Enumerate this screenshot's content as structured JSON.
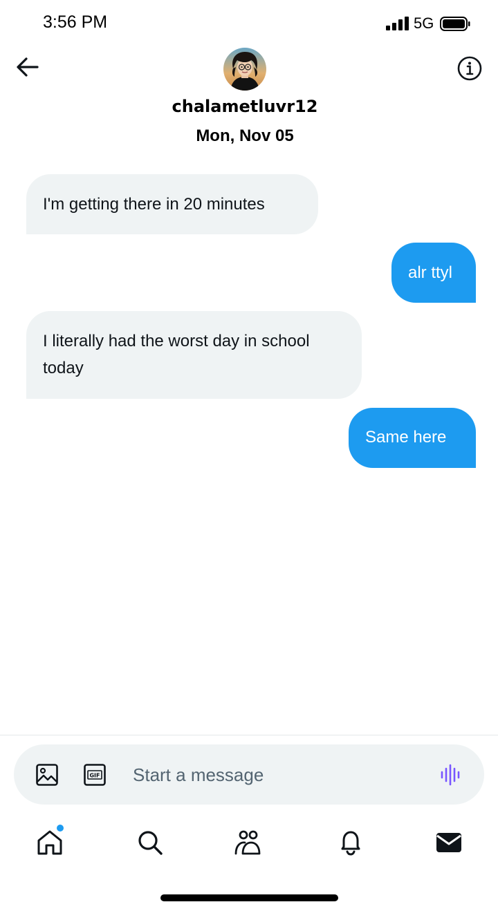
{
  "status_bar": {
    "time": "3:56 PM",
    "network": "5G",
    "icons": [
      "signal-icon",
      "battery-icon"
    ]
  },
  "header": {
    "back_icon": "arrow-left-icon",
    "info_icon": "info-icon",
    "username": "chalametluvr12",
    "date": "Mon, Nov 05"
  },
  "messages": [
    {
      "direction": "received",
      "text": "I'm getting there in 20 minutes"
    },
    {
      "direction": "sent",
      "text": "alr ttyl"
    },
    {
      "direction": "received",
      "text": "I literally had the worst day in school today"
    },
    {
      "direction": "sent",
      "text": "Same here"
    }
  ],
  "composer": {
    "placeholder": "Start a message",
    "value": "",
    "icons": [
      "image-icon",
      "gif-icon",
      "voice-wave-icon"
    ]
  },
  "bottom_nav": {
    "items": [
      "home-icon",
      "search-icon",
      "communities-icon",
      "bell-icon",
      "mail-icon"
    ],
    "active": "mail-icon",
    "home_has_notification_dot": true
  },
  "colors": {
    "accent": "#1d9bf0",
    "received_bubble": "#eff3f4",
    "text": "#0f1419",
    "voice_icon": "#7856ff"
  }
}
